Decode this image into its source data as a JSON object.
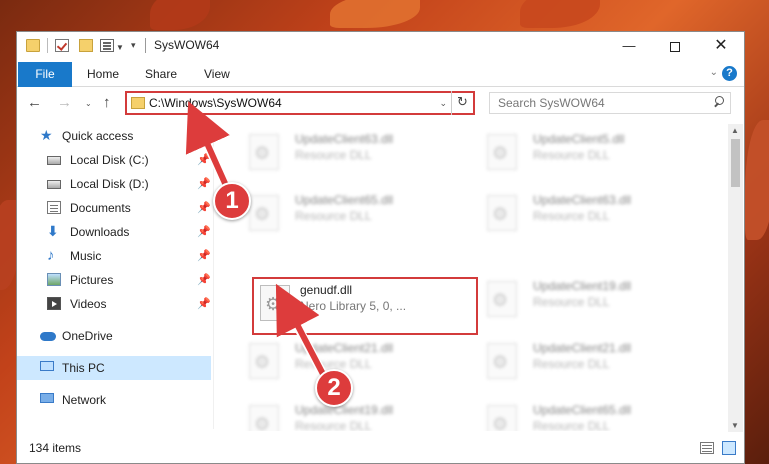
{
  "window": {
    "title": "SysWOW64",
    "minimize_label": "—",
    "close_label": "✕"
  },
  "ribbon": {
    "file": "File",
    "home": "Home",
    "share": "Share",
    "view": "View"
  },
  "address_bar": {
    "path": "C:\\Windows\\SysWOW64",
    "search_placeholder": "Search SysWOW64"
  },
  "nav_pane": {
    "quick_access": "Quick access",
    "items": [
      {
        "label": "Local Disk (C:)",
        "icon": "drive-icon",
        "pinned": true
      },
      {
        "label": "Local Disk (D:)",
        "icon": "drive-icon",
        "pinned": true
      },
      {
        "label": "Documents",
        "icon": "documents-icon",
        "pinned": true
      },
      {
        "label": "Downloads",
        "icon": "downloads-icon",
        "pinned": true
      },
      {
        "label": "Music",
        "icon": "music-icon",
        "pinned": true
      },
      {
        "label": "Pictures",
        "icon": "pictures-icon",
        "pinned": true
      },
      {
        "label": "Videos",
        "icon": "videos-icon",
        "pinned": true
      }
    ],
    "onedrive": "OneDrive",
    "this_pc": "This PC",
    "network": "Network"
  },
  "files": [
    {
      "name": "UpdateClient63.dll",
      "desc": "Resource DLL",
      "blurred": true
    },
    {
      "name": "UpdateClient5.dll",
      "desc": "Resource DLL",
      "blurred": true
    },
    {
      "name": "UpdateClient65.dll",
      "desc": "Resource DLL",
      "blurred": true
    },
    {
      "name": "UpdateClient63.dll",
      "desc": "Resource DLL",
      "blurred": true
    },
    {
      "name": "genudf.dll",
      "desc": "Nero Library 5, 0, ...",
      "selected": true
    },
    {
      "name": "UpdateClient19.dll",
      "desc": "Resource DLL",
      "blurred": true
    },
    {
      "name": "UpdateClient21.dll",
      "desc": "Resource DLL",
      "blurred": true
    },
    {
      "name": "UpdateClient21.dll",
      "desc": "Resource DLL",
      "blurred": true
    },
    {
      "name": "UpdateClient19.dll",
      "desc": "Resource DLL",
      "blurred": true
    },
    {
      "name": "UpdateClient65.dll",
      "desc": "Resource DLL",
      "blurred": true
    }
  ],
  "status": {
    "item_count": "134 items"
  },
  "annotations": {
    "step1": "1",
    "step2": "2",
    "color": "#dd3c3c"
  }
}
